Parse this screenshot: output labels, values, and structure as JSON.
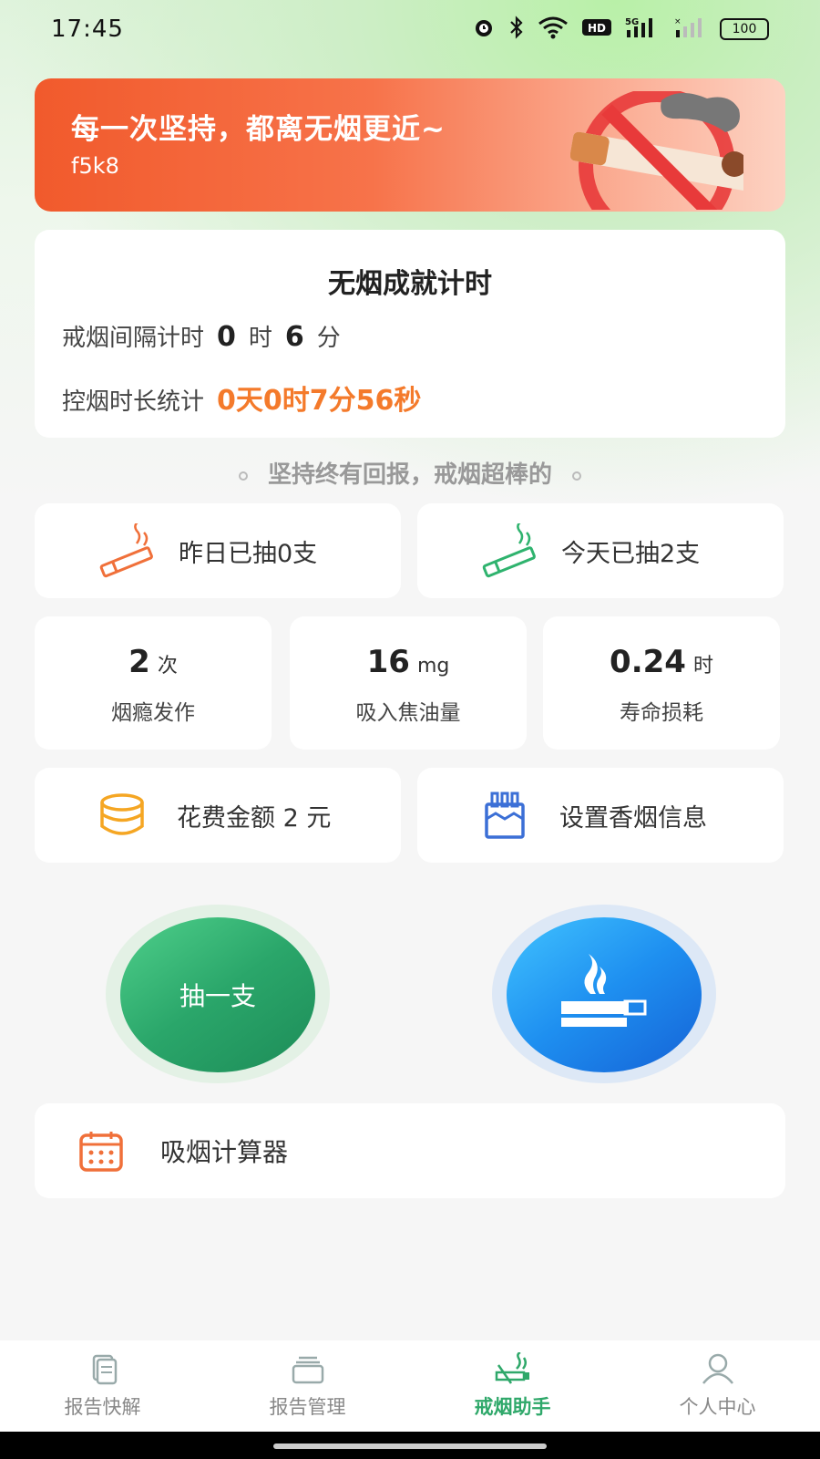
{
  "status_bar": {
    "time": "17:45",
    "battery": "100",
    "icons": [
      "alarm-icon",
      "bluetooth-icon",
      "wifi-icon",
      "hd-icon",
      "signal-5g-icon",
      "signal-icon"
    ]
  },
  "banner": {
    "title": "每一次坚持，都离无烟更近~",
    "subtitle": "f5k8"
  },
  "timer_card": {
    "title": "无烟成就计时",
    "interval_label": "戒烟间隔计时",
    "interval_hours": "0",
    "hour_unit": "时",
    "interval_minutes": "6",
    "minute_unit": "分",
    "duration_label": "控烟时长统计",
    "duration_value": "0天0时7分56秒"
  },
  "motto": "坚持终有回报，戒烟超棒的",
  "smoked": {
    "yesterday": "昨日已抽0支",
    "today": "今天已抽2支"
  },
  "stats": [
    {
      "value": "2",
      "unit": "次",
      "label": "烟瘾发作"
    },
    {
      "value": "16",
      "unit": "mg",
      "label": "吸入焦油量"
    },
    {
      "value": "0.24",
      "unit": "时",
      "label": "寿命损耗"
    }
  ],
  "cost": {
    "label": "花费金额 2 元"
  },
  "settings": {
    "label": "设置香烟信息"
  },
  "actions": {
    "smoke_label": "抽一支"
  },
  "calculator": {
    "label": "吸烟计算器"
  },
  "tabs": [
    {
      "label": "报告快解",
      "icon": "report-quick-icon",
      "active": false
    },
    {
      "label": "报告管理",
      "icon": "report-manage-icon",
      "active": false
    },
    {
      "label": "戒烟助手",
      "icon": "quit-smoking-icon",
      "active": true
    },
    {
      "label": "个人中心",
      "icon": "user-icon",
      "active": false
    }
  ],
  "colors": {
    "accent_green": "#2fa86a",
    "accent_orange": "#f47a2b",
    "banner_red": "#f15a2c",
    "blue_button": "#1e8ff0"
  }
}
